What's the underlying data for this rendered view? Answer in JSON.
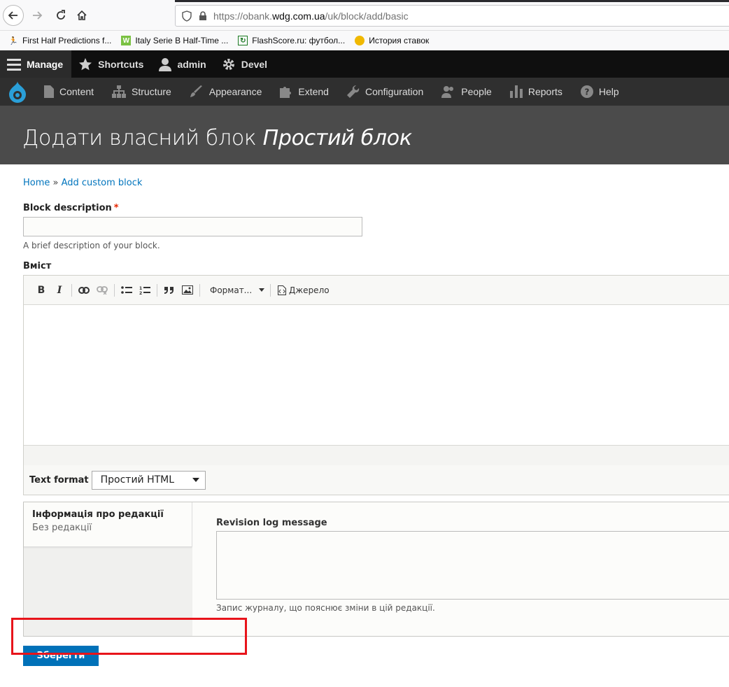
{
  "browser": {
    "url_prefix": "https://obank.",
    "url_domain": "wdg.com.ua",
    "url_path": "/uk/block/add/basic",
    "bookmarks": [
      {
        "label": "First Half Predictions f...",
        "icon": "runner-icon",
        "color": "#d9822b"
      },
      {
        "label": "Italy Serie B Half-Time ...",
        "icon": "w-logo-icon",
        "color": "#7ac142"
      },
      {
        "label": "FlashScore.ru: футбол...",
        "icon": "flashscore-icon",
        "color": "#1b7a22"
      },
      {
        "label": "История ставок",
        "icon": "coin-icon",
        "color": "#f0b800"
      }
    ]
  },
  "toolbar": {
    "manage": "Manage",
    "shortcuts": "Shortcuts",
    "user": "admin",
    "devel": "Devel"
  },
  "tray": {
    "content": "Content",
    "structure": "Structure",
    "appearance": "Appearance",
    "extend": "Extend",
    "configuration": "Configuration",
    "people": "People",
    "reports": "Reports",
    "help": "Help"
  },
  "page": {
    "title_main": "Додати власний блок ",
    "title_italic": "Простий блок"
  },
  "breadcrumb": {
    "home": "Home",
    "separator": " » ",
    "current": "Add custom block"
  },
  "form": {
    "description_label": "Block description",
    "required_mark": "*",
    "description_value": "",
    "description_help": "A brief description of your block.",
    "body_label": "Вміст",
    "format_dropdown": "Формат...",
    "source_label": "Джерело",
    "text_format_label": "Text format",
    "text_format_value": "Простий HTML",
    "vtab_title": "Інформація про редакції",
    "vtab_summary": "Без редакції",
    "revision_label": "Revision log message",
    "revision_value": "",
    "revision_help": "Запис журналу, що пояснює зміни в цій редакції.",
    "save_label": "Зберегти"
  },
  "colors": {
    "link": "#0074bd",
    "save_button": "#0071b8",
    "annotation_box": "#e8141b",
    "required": "#e62600"
  }
}
